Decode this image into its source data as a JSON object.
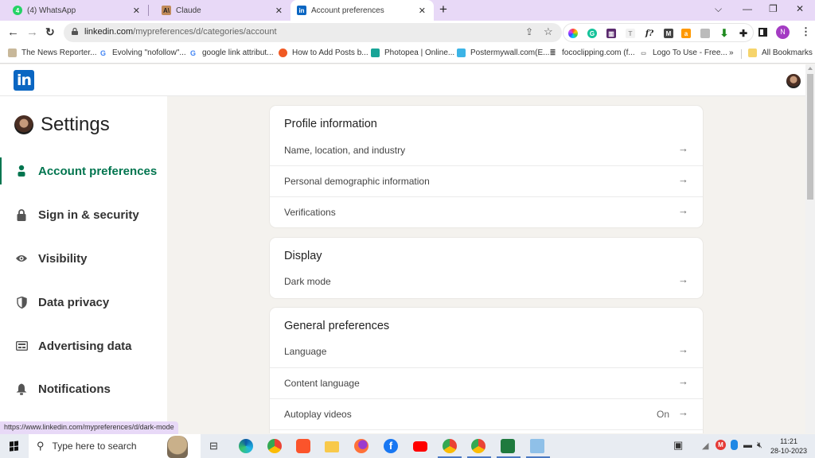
{
  "browser": {
    "tabs": [
      {
        "title": "(4) WhatsApp",
        "icon": "whatsapp-icon",
        "active": false
      },
      {
        "title": "Claude",
        "icon": "claude-icon",
        "active": false
      },
      {
        "title": "Account preferences",
        "icon": "linkedin-icon",
        "active": true
      }
    ],
    "new_tab": "+",
    "window_controls": {
      "tab_search": "⌵",
      "minimize": "—",
      "restore": "❐",
      "close": "✕"
    },
    "url_domain": "linkedin.com",
    "url_path": "/mypreferences/d/categories/account",
    "profile_initial": "N",
    "extensions": [
      "color-picker-icon",
      "grammarly-icon",
      "extension-chart-icon",
      "font-t-icon",
      "font-finder-icon",
      "m-extension-icon",
      "amazon-icon",
      "screenshot-icon",
      "download-arrow-icon",
      "puzzle-icon"
    ],
    "bookmarks": [
      "The News Reporter...",
      "Evolving \"nofollow\"...",
      "google link attribut...",
      "How to Add Posts b...",
      "Photopea | Online...",
      "Postermywall.com(E...",
      "fococlipping.com (f...",
      "Logo To Use - Free..."
    ],
    "bookmarks_overflow": "»",
    "all_bookmarks": "All Bookmarks",
    "status_url": "https://www.linkedin.com/mypreferences/d/dark-mode"
  },
  "page": {
    "logo": "in",
    "settings_title": "Settings",
    "nav": [
      {
        "label": "Account preferences",
        "icon": "person-icon",
        "active": true
      },
      {
        "label": "Sign in & security",
        "icon": "lock-icon",
        "active": false
      },
      {
        "label": "Visibility",
        "icon": "eye-icon",
        "active": false
      },
      {
        "label": "Data privacy",
        "icon": "shield-icon",
        "active": false
      },
      {
        "label": "Advertising data",
        "icon": "ad-card-icon",
        "active": false
      },
      {
        "label": "Notifications",
        "icon": "bell-icon",
        "active": false
      }
    ],
    "sections": [
      {
        "title": "Profile information",
        "rows": [
          {
            "label": "Name, location, and industry",
            "value": ""
          },
          {
            "label": "Personal demographic information",
            "value": ""
          },
          {
            "label": "Verifications",
            "value": ""
          }
        ]
      },
      {
        "title": "Display",
        "rows": [
          {
            "label": "Dark mode",
            "value": ""
          }
        ]
      },
      {
        "title": "General preferences",
        "rows": [
          {
            "label": "Language",
            "value": ""
          },
          {
            "label": "Content language",
            "value": ""
          },
          {
            "label": "Autoplay videos",
            "value": "On"
          }
        ]
      }
    ],
    "arrow": "→"
  },
  "taskbar": {
    "search_placeholder": "Type here to search",
    "time": "11:21",
    "date": "28-10-2023"
  }
}
